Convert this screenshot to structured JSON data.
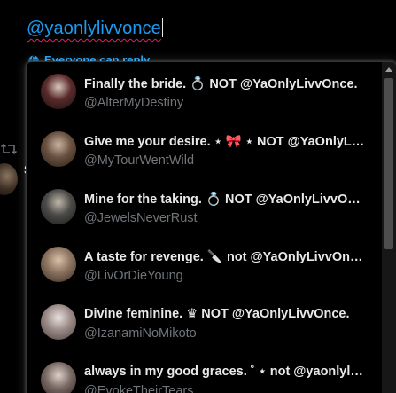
{
  "composer": {
    "text": "@yaonlylivvonce",
    "reply_setting": "Everyone can reply"
  },
  "background": {
    "retweet_icon": "retweet-icon",
    "partial_letter": "S"
  },
  "suggestions": [
    {
      "name": "Finally the bride. 💍 NOT @YaOnlyLivvOnce.",
      "handle": "@AlterMyDestiny",
      "avatar_color": "#6b3a3a"
    },
    {
      "name": "Give me your desire. ⋆ 🎀 ⋆ NOT @YaOnlyLivvOnce.",
      "handle": "@MyTourWentWild",
      "avatar_color": "#6a5a4a"
    },
    {
      "name": "Mine for the taking. 💍 NOT @YaOnlyLivvOnce.",
      "handle": "@JewelsNeverRust",
      "avatar_color": "#4a4a48"
    },
    {
      "name": "A taste for revenge. 🔪 not @YaOnlyLivvOnce.",
      "handle": "@LivOrDieYoung",
      "avatar_color": "#8a7260"
    },
    {
      "name": "Divine feminine. ♛ NOT @YaOnlyLivvOnce.",
      "handle": "@IzanamiNoMikoto",
      "avatar_color": "#9a8a86"
    },
    {
      "name": "always in my good graces. ˚ ⋆ not @yaonlylivvonce.",
      "handle": "@EvokeTheirTears",
      "avatar_color": "#7a6a66"
    }
  ],
  "colors": {
    "accent": "#1d9bf0",
    "name_text": "#e7e9ea",
    "handle_text": "#71767b",
    "popup_bg": "#000000",
    "spell_underline": "#e0245e"
  }
}
